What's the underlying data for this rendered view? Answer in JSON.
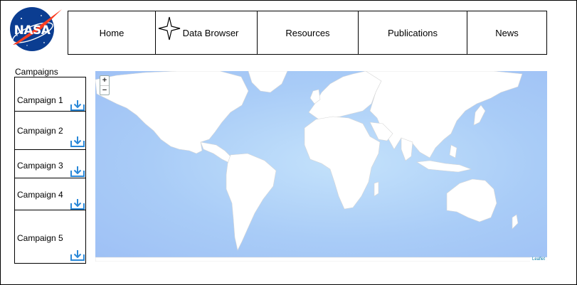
{
  "logo": {
    "text": "NASA",
    "icon": "nasa-meatball-logo",
    "colors": {
      "blue": "#0b3d91",
      "red": "#fc3d21"
    }
  },
  "nav": {
    "items": [
      {
        "label": "Home"
      },
      {
        "label": "Data Browser",
        "icon": "four-point-star-icon"
      },
      {
        "label": "Resources"
      },
      {
        "label": "Publications"
      },
      {
        "label": "News"
      }
    ]
  },
  "sidebar": {
    "heading": "Campaigns",
    "campaigns": [
      {
        "label": "Campaign 1",
        "icon": "download-icon"
      },
      {
        "label": "Campaign 2",
        "icon": "download-icon"
      },
      {
        "label": "Campaign 3",
        "icon": "download-icon"
      },
      {
        "label": "Campaign 4",
        "icon": "download-icon"
      },
      {
        "label": "Campaign 5",
        "icon": "download-icon"
      }
    ]
  },
  "map": {
    "zoom_in": "+",
    "zoom_out": "−",
    "attribution": "Leaflet",
    "colors": {
      "ocean": "#a9ccf7",
      "land": "#ffffff",
      "icon": "#2a88d8"
    }
  }
}
